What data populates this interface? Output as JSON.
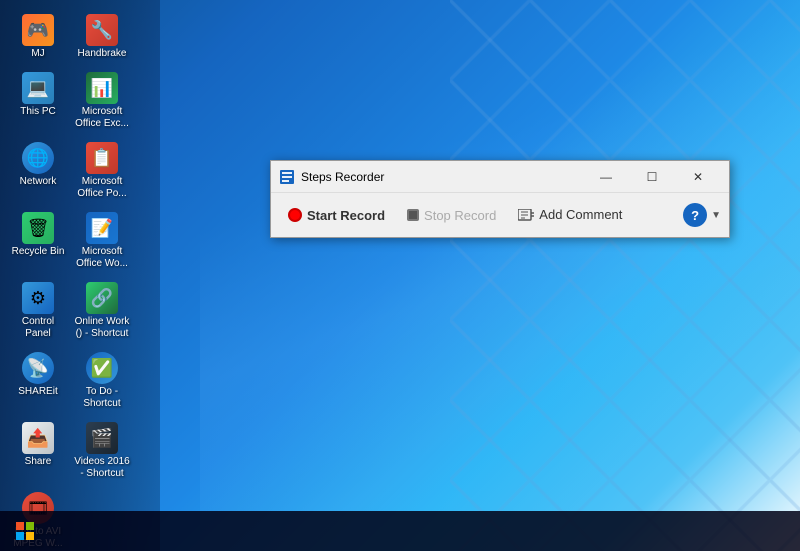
{
  "desktop": {
    "background_colors": [
      "#0d4f8c",
      "#1565c0",
      "#29b6f6"
    ]
  },
  "icons": [
    {
      "id": "mi",
      "label": "MJ",
      "emoji": "🎮",
      "style_class": "icon-mi"
    },
    {
      "id": "handbrake",
      "label": "Handbrake",
      "emoji": "🔧",
      "style_class": "icon-handbrake"
    },
    {
      "id": "this-pc",
      "label": "This PC",
      "emoji": "💻",
      "style_class": "icon-pc"
    },
    {
      "id": "ms-excel",
      "label": "Microsoft Office Exc...",
      "emoji": "📊",
      "style_class": "icon-excel"
    },
    {
      "id": "network",
      "label": "Network",
      "emoji": "🌐",
      "style_class": "icon-network"
    },
    {
      "id": "ms-powerpoint",
      "label": "Microsoft Office Po...",
      "emoji": "📋",
      "style_class": "icon-powerpoint"
    },
    {
      "id": "recycle",
      "label": "Recycle Bin",
      "emoji": "🗑",
      "style_class": "icon-recycle"
    },
    {
      "id": "ms-word",
      "label": "Microsoft Office Wo...",
      "emoji": "📝",
      "style_class": "icon-word"
    },
    {
      "id": "control-panel",
      "label": "Control Panel",
      "emoji": "⚙",
      "style_class": "icon-control"
    },
    {
      "id": "online-work",
      "label": "Online Work () - Shortcut",
      "emoji": "🔗",
      "style_class": "icon-online"
    },
    {
      "id": "shareit",
      "label": "SHAREit",
      "emoji": "📡",
      "style_class": "icon-shareit"
    },
    {
      "id": "todo",
      "label": "To Do - Shortcut",
      "emoji": "✅",
      "style_class": "icon-todo"
    },
    {
      "id": "share",
      "label": "Share",
      "emoji": "📤",
      "style_class": "icon-share"
    },
    {
      "id": "videos",
      "label": "Videos 2016 - Shortcut",
      "emoji": "🎬",
      "style_class": "icon-videos"
    },
    {
      "id": "flv-avi",
      "label": "FLV to AVI MPEG W...",
      "emoji": "🎞",
      "style_class": "icon-flv"
    }
  ],
  "steps_recorder": {
    "title": "Steps Recorder",
    "window_icon": "📋",
    "buttons": {
      "start_record": {
        "label": "Start Record",
        "bold": true
      },
      "stop_record": {
        "label": "Stop Record",
        "disabled": true
      },
      "add_comment": {
        "label": "Add Comment",
        "disabled": false
      }
    },
    "window_controls": {
      "minimize": "—",
      "maximize": "☐",
      "close": "✕"
    }
  }
}
